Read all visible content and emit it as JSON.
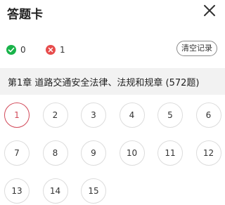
{
  "header": {
    "title": "答题卡",
    "close_icon": "close-icon"
  },
  "stats": {
    "correct": {
      "icon": "check-circle-icon",
      "count": "0",
      "color": "#19b34a"
    },
    "wrong": {
      "icon": "x-circle-icon",
      "count": "1",
      "color": "#e74c4c"
    },
    "clear_label": "清空记录"
  },
  "chapter": {
    "title": "第1章  道路交通安全法律、法规和规章 (572题)"
  },
  "questions": [
    "1",
    "2",
    "3",
    "4",
    "5",
    "6",
    "7",
    "8",
    "9",
    "10",
    "11",
    "12",
    "13",
    "14",
    "15"
  ],
  "current_question": "1",
  "colors": {
    "accent": "#d24a5a",
    "bar_bg": "#f2f2f2"
  }
}
